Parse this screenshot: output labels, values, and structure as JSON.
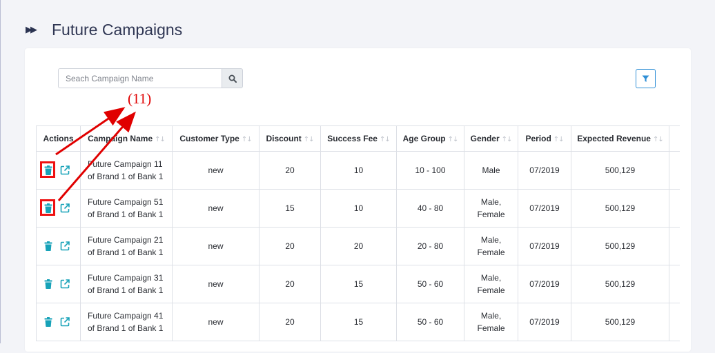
{
  "header": {
    "title": "Future Campaigns",
    "icon": "fast-forward-icon"
  },
  "search": {
    "placeholder": "Seach Campaign Name",
    "value": ""
  },
  "annotation": {
    "label": "(11)",
    "color": "#e00000"
  },
  "table": {
    "columns": [
      "Actions",
      "Campaign Name",
      "Customer Type",
      "Discount",
      "Success Fee",
      "Age Group",
      "Gender",
      "Period",
      "Expected Revenue"
    ],
    "rows": [
      {
        "name_line1": "Future Campaign 11",
        "name_line2": "of Brand 1 of Bank 1",
        "customer_type": "new",
        "discount": "20",
        "success_fee": "10",
        "age_group": "10 - 100",
        "gender_line1": "Male",
        "gender_line2": "",
        "period": "07/2019",
        "revenue": "500,129",
        "highlighted": true
      },
      {
        "name_line1": "Future Campaign 51",
        "name_line2": "of Brand 1 of Bank 1",
        "customer_type": "new",
        "discount": "15",
        "success_fee": "10",
        "age_group": "40 - 80",
        "gender_line1": "Male,",
        "gender_line2": "Female",
        "period": "07/2019",
        "revenue": "500,129",
        "highlighted": true
      },
      {
        "name_line1": "Future Campaign 21",
        "name_line2": "of Brand 1 of Bank 1",
        "customer_type": "new",
        "discount": "20",
        "success_fee": "20",
        "age_group": "20 - 80",
        "gender_line1": "Male,",
        "gender_line2": "Female",
        "period": "07/2019",
        "revenue": "500,129",
        "highlighted": false
      },
      {
        "name_line1": "Future Campaign 31",
        "name_line2": "of Brand 1 of Bank 1",
        "customer_type": "new",
        "discount": "20",
        "success_fee": "15",
        "age_group": "50 - 60",
        "gender_line1": "Male,",
        "gender_line2": "Female",
        "period": "07/2019",
        "revenue": "500,129",
        "highlighted": false
      },
      {
        "name_line1": "Future Campaign 41",
        "name_line2": "of Brand 1 of Bank 1",
        "customer_type": "new",
        "discount": "20",
        "success_fee": "15",
        "age_group": "50 - 60",
        "gender_line1": "Male,",
        "gender_line2": "Female",
        "period": "07/2019",
        "revenue": "500,129",
        "highlighted": false
      }
    ]
  },
  "colors": {
    "accent": "#2f8fd6",
    "action_icon": "#17a2b8",
    "title": "#2f3653",
    "highlight": "#e11111"
  }
}
